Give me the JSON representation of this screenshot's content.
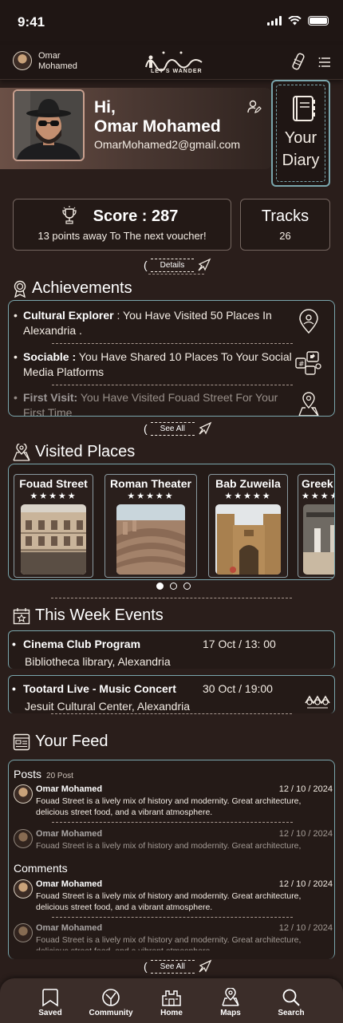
{
  "status": {
    "time": "9:41"
  },
  "header": {
    "user_name_line1": "Omar",
    "user_name_line2": "Mohamed",
    "logo_text": "LET'S WANDER"
  },
  "profile": {
    "greeting": "Hi,",
    "name": "Omar Mohamed",
    "email": "OmarMohamed2@gmail.com",
    "diary_line1": "Your",
    "diary_line2": "Diary"
  },
  "score": {
    "title": "Score : 287",
    "subtitle": "13 points away To The next voucher!",
    "tracks_label": "Tracks",
    "tracks_value": "26",
    "details_label": "Details"
  },
  "achievements": {
    "title": "Achievements",
    "items": [
      {
        "name": "Cultural Explorer",
        "sep": " : ",
        "text": "You Have Visited 50 Places In Alexandria ."
      },
      {
        "name": "Sociable :",
        "sep": " ",
        "text": "You Have Shared 10 Places To Your Social Media Platforms"
      },
      {
        "name": "First Visit:",
        "sep": " ",
        "text": "You Have Visited Fouad Street For Your First Time"
      }
    ],
    "see_all": "See All"
  },
  "visited": {
    "title": "Visited Places",
    "places": [
      {
        "name": "Fouad Street",
        "stars": "★★★★★"
      },
      {
        "name": "Roman Theater",
        "stars": "★★★★★"
      },
      {
        "name": "Bab Zuweila",
        "stars": "★★★★★"
      },
      {
        "name": "Greek",
        "stars": "★★★★★"
      }
    ]
  },
  "events": {
    "title": "This Week Events",
    "items": [
      {
        "name": "Cinema Club Program",
        "date": "17 Oct / 13: 00",
        "place": "Bibliotheca library, Alexandria"
      },
      {
        "name": "Tootard Live - Music Concert",
        "date": "30 Oct  / 19:00",
        "place": "Jesuit Cultural Center, Alexandria"
      }
    ]
  },
  "feed": {
    "title": "Your Feed",
    "posts_label": "Posts",
    "posts_count": "20 Post",
    "comments_label": "Comments",
    "posts": [
      {
        "author": "Omar Mohamed",
        "date": "12 / 10 / 2024",
        "text": "Fouad Street is a lively mix of history and modernity. Great architecture, delicious street food, and a vibrant atmosphere."
      },
      {
        "author": "Omar Mohamed",
        "date": "12 / 10 / 2024",
        "text": "Fouad Street is a lively mix of history and modernity. Great architecture, delicious street food, and a vibrant atmosphere."
      }
    ],
    "comments": [
      {
        "author": "Omar Mohamed",
        "date": "12 / 10 / 2024",
        "text": "Fouad Street is a lively mix of history and modernity. Great architecture, delicious street food, and a vibrant atmosphere."
      },
      {
        "author": "Omar Mohamed",
        "date": "12 / 10 / 2024",
        "text": "Fouad Street is a lively mix of history and modernity. Great architecture, delicious street food, and a vibrant atmosphere."
      }
    ],
    "see_all": "See All"
  },
  "nav": {
    "saved": "Saved",
    "community": "Community",
    "home": "Home",
    "maps": "Maps",
    "search": "Search"
  },
  "colors": {
    "background": "#2a1e1b",
    "accent": "#7aa6ad",
    "card": "#231916"
  }
}
